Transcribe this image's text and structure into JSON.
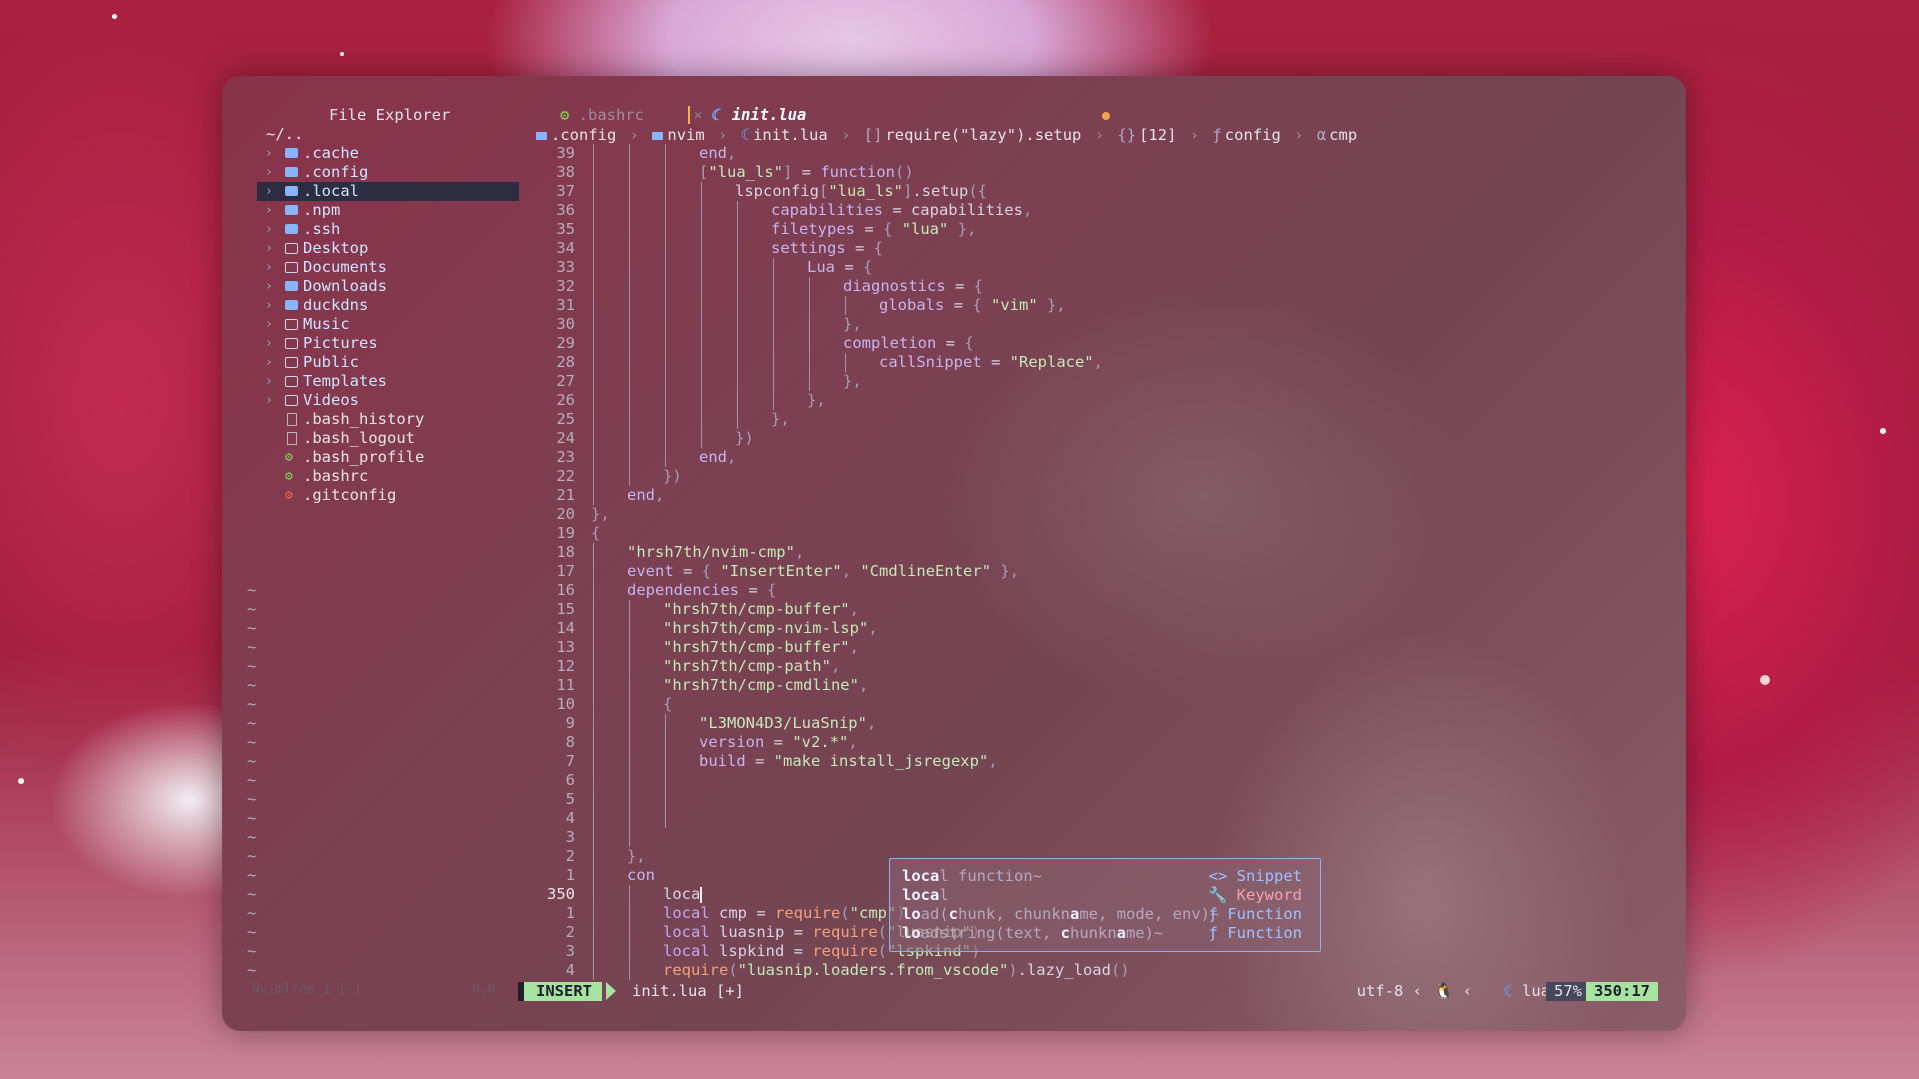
{
  "sidebar": {
    "title": "File Explorer",
    "root": "~/..",
    "items": [
      {
        "name": ".cache",
        "kind": "folder-hidden"
      },
      {
        "name": ".config",
        "kind": "folder-hidden"
      },
      {
        "name": ".local",
        "kind": "folder-hidden",
        "selected": true
      },
      {
        "name": ".npm",
        "kind": "folder-hidden"
      },
      {
        "name": ".ssh",
        "kind": "folder-hidden"
      },
      {
        "name": "Desktop",
        "kind": "folder"
      },
      {
        "name": "Documents",
        "kind": "folder"
      },
      {
        "name": "Downloads",
        "kind": "folder-hidden"
      },
      {
        "name": "duckdns",
        "kind": "folder-hidden"
      },
      {
        "name": "Music",
        "kind": "folder"
      },
      {
        "name": "Pictures",
        "kind": "folder"
      },
      {
        "name": "Public",
        "kind": "folder"
      },
      {
        "name": "Templates",
        "kind": "folder"
      },
      {
        "name": "Videos",
        "kind": "folder"
      },
      {
        "name": ".bash_history",
        "kind": "file"
      },
      {
        "name": ".bash_logout",
        "kind": "file"
      },
      {
        "name": ".bash_profile",
        "kind": "config"
      },
      {
        "name": ".bashrc",
        "kind": "config"
      },
      {
        "name": ".gitconfig",
        "kind": "git"
      }
    ]
  },
  "tabs": [
    {
      "label": ".bashrc",
      "active": false,
      "close": "×"
    },
    {
      "label": "init.lua",
      "active": true,
      "modified": true
    }
  ],
  "breadcrumb": {
    "parts": [
      ".config",
      "nvim",
      "init.lua",
      "require(\"lazy\").setup",
      "[12]",
      "config",
      "cmp"
    ],
    "symbols": [
      "",
      "",
      "",
      "[]",
      "{}",
      "ƒ",
      "α"
    ]
  },
  "code": [
    {
      "ln": "39",
      "indent": 4,
      "html": "<span class=\"k\">end</span><span class=\"p\">,</span>"
    },
    {
      "ln": "38",
      "indent": 4,
      "html": "<span class=\"p\">[</span><span class=\"s\">\"lua_ls\"</span><span class=\"p\">]</span> = <span class=\"k\">function</span><span class=\"p\">()</span>"
    },
    {
      "ln": "37",
      "indent": 5,
      "html": "lspconfig<span class=\"p\">[</span><span class=\"s\">\"lua_ls\"</span><span class=\"p\">]</span>.setup<span class=\"p\">({</span>"
    },
    {
      "ln": "36",
      "indent": 6,
      "html": "<span class=\"k\">capabilities</span> = capabilities<span class=\"p\">,</span>"
    },
    {
      "ln": "35",
      "indent": 6,
      "html": "<span class=\"k\">filetypes</span> = <span class=\"p\">{</span> <span class=\"s\">\"lua\"</span> <span class=\"p\">},</span>"
    },
    {
      "ln": "34",
      "indent": 6,
      "html": "<span class=\"k\">settings</span> = <span class=\"p\">{</span>"
    },
    {
      "ln": "33",
      "indent": 7,
      "html": "<span class=\"k\">Lua</span> = <span class=\"p\">{</span>"
    },
    {
      "ln": "32",
      "indent": 8,
      "html": "<span class=\"k\">diagnostics</span> = <span class=\"p\">{</span>"
    },
    {
      "ln": "31",
      "indent": 9,
      "html": "<span class=\"k\">globals</span> = <span class=\"p\">{</span> <span class=\"s\">\"vim\"</span> <span class=\"p\">},</span>"
    },
    {
      "ln": "30",
      "indent": 8,
      "html": "<span class=\"p\">},</span>"
    },
    {
      "ln": "29",
      "indent": 8,
      "html": "<span class=\"k\">completion</span> = <span class=\"p\">{</span>"
    },
    {
      "ln": "28",
      "indent": 9,
      "html": "<span class=\"k\">callSnippet</span> = <span class=\"s\">\"Replace\"</span><span class=\"p\">,</span>"
    },
    {
      "ln": "27",
      "indent": 8,
      "html": "<span class=\"p\">},</span>"
    },
    {
      "ln": "26",
      "indent": 7,
      "html": "<span class=\"p\">},</span>"
    },
    {
      "ln": "25",
      "indent": 6,
      "html": "<span class=\"p\">},</span>"
    },
    {
      "ln": "24",
      "indent": 5,
      "html": "<span class=\"p\">})</span>"
    },
    {
      "ln": "23",
      "indent": 4,
      "html": "<span class=\"k\">end</span><span class=\"p\">,</span>"
    },
    {
      "ln": "22",
      "indent": 3,
      "html": "<span class=\"p\">})</span>"
    },
    {
      "ln": "21",
      "indent": 2,
      "html": "<span class=\"k\">end</span><span class=\"p\">,</span>"
    },
    {
      "ln": "20",
      "indent": 1,
      "html": "<span class=\"p\">},</span>"
    },
    {
      "ln": "19",
      "indent": 1,
      "html": "<span class=\"p\">{</span>"
    },
    {
      "ln": "18",
      "indent": 2,
      "html": "<span class=\"s\">\"hrsh7th/nvim-cmp\"</span><span class=\"p\">,</span>"
    },
    {
      "ln": "17",
      "indent": 2,
      "html": "<span class=\"k\">event</span> = <span class=\"p\">{</span> <span class=\"s\">\"InsertEnter\"</span><span class=\"p\">,</span> <span class=\"s\">\"CmdlineEnter\"</span> <span class=\"p\">},</span>"
    },
    {
      "ln": "16",
      "indent": 2,
      "html": "<span class=\"k\">dependencies</span> = <span class=\"p\">{</span>"
    },
    {
      "ln": "15",
      "indent": 3,
      "html": "<span class=\"s\">\"hrsh7th/cmp-buffer\"</span><span class=\"p\">,</span>"
    },
    {
      "ln": "14",
      "indent": 3,
      "html": "<span class=\"s\">\"hrsh7th/cmp-nvim-lsp\"</span><span class=\"p\">,</span>"
    },
    {
      "ln": "13",
      "indent": 3,
      "html": "<span class=\"s\">\"hrsh7th/cmp-buffer\"</span><span class=\"p\">,</span>"
    },
    {
      "ln": "12",
      "indent": 3,
      "html": "<span class=\"s\">\"hrsh7th/cmp-path\"</span><span class=\"p\">,</span>"
    },
    {
      "ln": "11",
      "indent": 3,
      "html": "<span class=\"s\">\"hrsh7th/cmp-cmdline\"</span><span class=\"p\">,</span>"
    },
    {
      "ln": "10",
      "indent": 3,
      "html": "<span class=\"p\">{</span>"
    },
    {
      "ln": "9",
      "indent": 4,
      "html": "<span class=\"s\">\"L3MON4D3/LuaSnip\"</span><span class=\"p\">,</span>"
    },
    {
      "ln": "8",
      "indent": 4,
      "html": "<span class=\"k\">version</span> = <span class=\"s\">\"v2.*\"</span><span class=\"p\">,</span>"
    },
    {
      "ln": "7",
      "indent": 4,
      "html": "<span class=\"k\">build</span> = <span class=\"s\">\"make install_jsregexp\"</span><span class=\"p\">,</span>"
    },
    {
      "ln": "6",
      "indent": 4,
      "html": ""
    },
    {
      "ln": "5",
      "indent": 4,
      "html": ""
    },
    {
      "ln": "4",
      "indent": 4,
      "html": ""
    },
    {
      "ln": "3",
      "indent": 3,
      "html": ""
    },
    {
      "ln": "2",
      "indent": 2,
      "html": "<span class=\"p\">},</span>"
    },
    {
      "ln": "1",
      "indent": 2,
      "html": "<span class=\"k\">con</span>"
    },
    {
      "ln": "350",
      "indent": 3,
      "html": "loca<span class=\"cursor\"></span>",
      "current": true
    },
    {
      "ln": "1",
      "indent": 3,
      "html": "<span class=\"kw\">local</span> cmp = <span class=\"req\">require</span><span class=\"p\">(</span><span class=\"s\">\"cmp\"</span><span class=\"p\">)</span>"
    },
    {
      "ln": "2",
      "indent": 3,
      "html": "<span class=\"kw\">local</span> luasnip = <span class=\"req\">require</span><span class=\"p\">(</span><span class=\"s\">\"luasnip\"</span><span class=\"p\">)</span>"
    },
    {
      "ln": "3",
      "indent": 3,
      "html": "<span class=\"kw\">local</span> lspkind = <span class=\"req\">require</span><span class=\"p\">(</span><span class=\"s\">\"lspkind\"</span><span class=\"p\">)</span>"
    },
    {
      "ln": "4",
      "indent": 3,
      "html": "<span class=\"req\">require</span><span class=\"p\">(</span><span class=\"s\">\"luasnip.loaders.from_vscode\"</span><span class=\"p\">)</span>.lazy_load<span class=\"p\">()</span>"
    }
  ],
  "completion": [
    {
      "html": "<span class=\"comp-match\">loca</span><span class=\"comp-rest\">l function~</span>",
      "kind": "Snippet",
      "kind_icon": "<>",
      "kind_class": "kind-snip"
    },
    {
      "html": "<span class=\"comp-match\">loca</span><span class=\"comp-rest\">l</span>",
      "kind": "Keyword",
      "kind_icon": "🔧",
      "kind_class": "kind-kw"
    },
    {
      "html": "<span class=\"comp-match\">lo</span><span class=\"comp-rest\">ad(</span><span class=\"comp-match\">c</span><span class=\"comp-rest\">hunk, chunkn</span><span class=\"comp-match\">a</span><span class=\"comp-rest\">me, mode, env)~</span>",
      "kind": "Function",
      "kind_icon": "ƒ",
      "kind_class": "kind-fn"
    },
    {
      "html": "<span class=\"comp-match\">lo</span><span class=\"comp-rest\">adstring(text, </span><span class=\"comp-match\">c</span><span class=\"comp-rest\">hunkn</span><span class=\"comp-match\">a</span><span class=\"comp-rest\">me)~</span>",
      "kind": "Function",
      "kind_icon": "ƒ",
      "kind_class": "kind-fn"
    }
  ],
  "statusbar": {
    "mode": "INSERT",
    "file": "init.lua [+]",
    "encoding": "utf-8",
    "filetype": "lua",
    "percent": "57%",
    "position": "350:17",
    "sidebar_left": "NvimTree_1 [-]",
    "sidebar_right": "0,0"
  },
  "colors": {
    "accent_green": "#a6e3a1",
    "folder_blue": "#89b4fa",
    "string_green": "#c4e8b8"
  }
}
